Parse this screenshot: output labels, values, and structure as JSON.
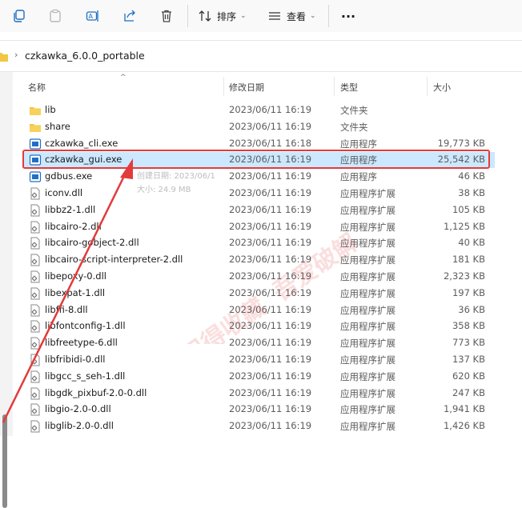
{
  "toolbar": {
    "sort_label": "排序",
    "view_label": "查看",
    "more_label": "···"
  },
  "address": {
    "path": "czkawka_6.0.0_portable"
  },
  "columns": {
    "name": "名称",
    "modified": "修改日期",
    "type": "类型",
    "size": "大小"
  },
  "files": [
    {
      "name": "lib",
      "date": "2023/06/11 16:19",
      "type": "文件夹",
      "size": "",
      "icon": "folder-icon"
    },
    {
      "name": "share",
      "date": "2023/06/11 16:19",
      "type": "文件夹",
      "size": "",
      "icon": "folder-icon"
    },
    {
      "name": "czkawka_cli.exe",
      "date": "2023/06/11 16:18",
      "type": "应用程序",
      "size": "19,773 KB",
      "icon": "exe-icon"
    },
    {
      "name": "czkawka_gui.exe",
      "date": "2023/06/11 16:19",
      "type": "应用程序",
      "size": "25,542 KB",
      "icon": "exe-icon"
    },
    {
      "name": "gdbus.exe",
      "date": "2023/06/11 16:19",
      "type": "应用程序",
      "size": "46 KB",
      "icon": "exe-icon"
    },
    {
      "name": "iconv.dll",
      "date": "2023/06/11 16:19",
      "type": "应用程序扩展",
      "size": "38 KB",
      "icon": "dll-icon"
    },
    {
      "name": "libbz2-1.dll",
      "date": "2023/06/11 16:19",
      "type": "应用程序扩展",
      "size": "105 KB",
      "icon": "dll-icon"
    },
    {
      "name": "libcairo-2.dll",
      "date": "2023/06/11 16:19",
      "type": "应用程序扩展",
      "size": "1,125 KB",
      "icon": "dll-icon"
    },
    {
      "name": "libcairo-gobject-2.dll",
      "date": "2023/06/11 16:19",
      "type": "应用程序扩展",
      "size": "40 KB",
      "icon": "dll-icon"
    },
    {
      "name": "libcairo-script-interpreter-2.dll",
      "date": "2023/06/11 16:19",
      "type": "应用程序扩展",
      "size": "181 KB",
      "icon": "dll-icon"
    },
    {
      "name": "libepoxy-0.dll",
      "date": "2023/06/11 16:19",
      "type": "应用程序扩展",
      "size": "2,323 KB",
      "icon": "dll-icon"
    },
    {
      "name": "libexpat-1.dll",
      "date": "2023/06/11 16:19",
      "type": "应用程序扩展",
      "size": "197 KB",
      "icon": "dll-icon"
    },
    {
      "name": "libffi-8.dll",
      "date": "2023/06/11 16:19",
      "type": "应用程序扩展",
      "size": "36 KB",
      "icon": "dll-icon"
    },
    {
      "name": "libfontconfig-1.dll",
      "date": "2023/06/11 16:19",
      "type": "应用程序扩展",
      "size": "358 KB",
      "icon": "dll-icon"
    },
    {
      "name": "libfreetype-6.dll",
      "date": "2023/06/11 16:19",
      "type": "应用程序扩展",
      "size": "773 KB",
      "icon": "dll-icon"
    },
    {
      "name": "libfribidi-0.dll",
      "date": "2023/06/11 16:19",
      "type": "应用程序扩展",
      "size": "137 KB",
      "icon": "dll-icon"
    },
    {
      "name": "libgcc_s_seh-1.dll",
      "date": "2023/06/11 16:19",
      "type": "应用程序扩展",
      "size": "620 KB",
      "icon": "dll-icon"
    },
    {
      "name": "libgdk_pixbuf-2.0-0.dll",
      "date": "2023/06/11 16:19",
      "type": "应用程序扩展",
      "size": "247 KB",
      "icon": "dll-icon"
    },
    {
      "name": "libgio-2.0-0.dll",
      "date": "2023/06/11 16:19",
      "type": "应用程序扩展",
      "size": "1,941 KB",
      "icon": "dll-icon"
    },
    {
      "name": "libglib-2.0-0.dll",
      "date": "2023/06/11 16:19",
      "type": "应用程序扩展",
      "size": "1,426 KB",
      "icon": "dll-icon"
    }
  ],
  "selected_index": 3,
  "tooltip": {
    "line1": "创建日期: 2023/06/1",
    "line2": "大小: 24.9 MB"
  },
  "watermark": {
    "line1": "记得收藏",
    "line2": "吾爱破解"
  },
  "colors": {
    "selection": "#cce8ff",
    "highlight_box": "#e23b3b",
    "arrow": "#e23b3b",
    "folder": "#f4c542",
    "exe": "#1e6fc5"
  }
}
